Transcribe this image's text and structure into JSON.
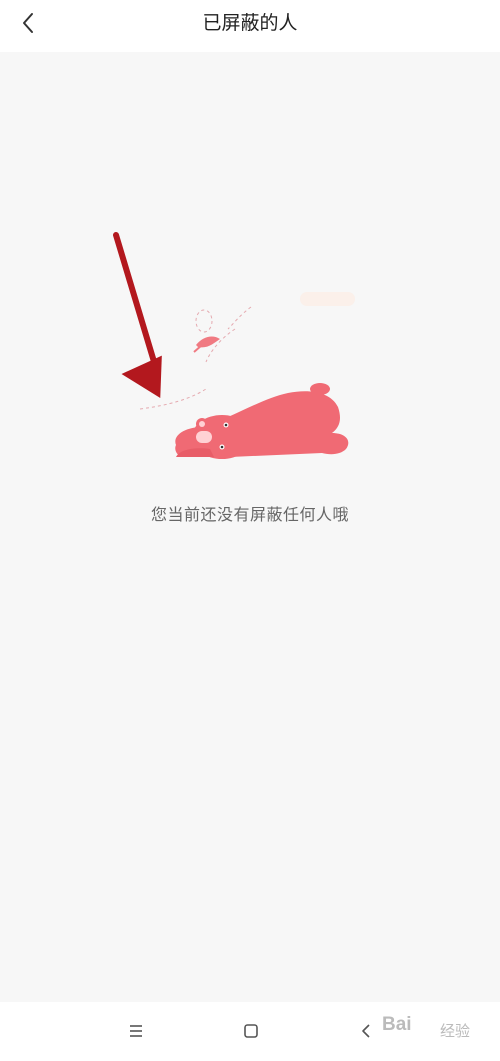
{
  "header": {
    "title": "已屏蔽的人",
    "back_icon": "chevron-left-icon"
  },
  "empty_state": {
    "message": "您当前还没有屏蔽任何人哦",
    "illustration": "sleeping-bear-illustration",
    "illustration_color": "#f06a74"
  },
  "annotation": {
    "arrow_icon": "red-arrow-annotation",
    "arrow_color": "#b3181e"
  },
  "navbar": {
    "menu_icon": "menu-icon",
    "home_icon": "home-square-icon",
    "back_icon": "back-triangle-icon"
  },
  "watermark": {
    "brand": "Bai",
    "sub": "经验"
  }
}
